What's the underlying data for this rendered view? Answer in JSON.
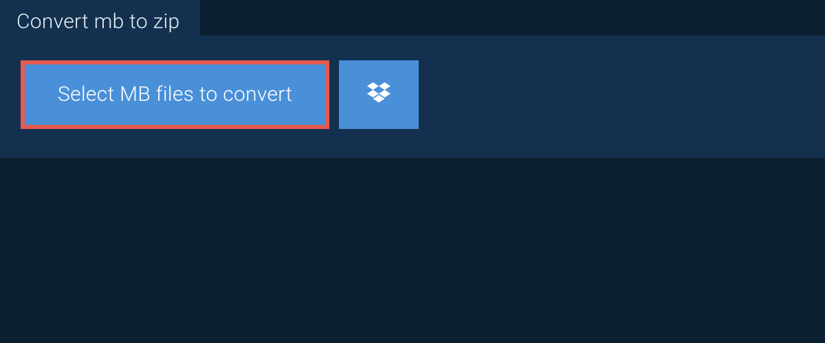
{
  "tab": {
    "label": "Convert mb to zip"
  },
  "actions": {
    "select_label": "Select MB files to convert"
  }
}
